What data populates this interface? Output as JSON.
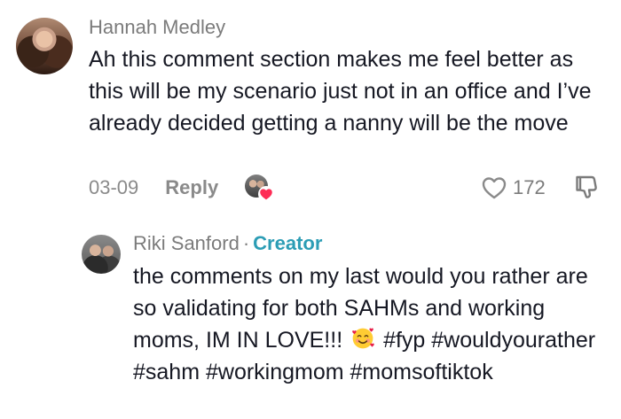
{
  "comment": {
    "username": "Hannah Medley",
    "text": "Ah this comment section makes me feel better as this will be my scenario just not in an office and I’ve already decided getting a nanny will be the move",
    "date": "03-09",
    "reply_label": "Reply",
    "like_count": "172",
    "heart_color": "#fe2c55",
    "creator_color": "#2c9db5"
  },
  "reply": {
    "username": "Riki Sanford",
    "separator": "·",
    "badge": "Creator",
    "text_before_emoji": "the comments on my last would you rather are so validating for both SAHMs and working moms, IM IN LOVE!!!",
    "emoji": "smiling-face-with-hearts",
    "text_after_emoji": "#fyp #wouldyourather #sahm #workingmom #momsoftiktok"
  }
}
